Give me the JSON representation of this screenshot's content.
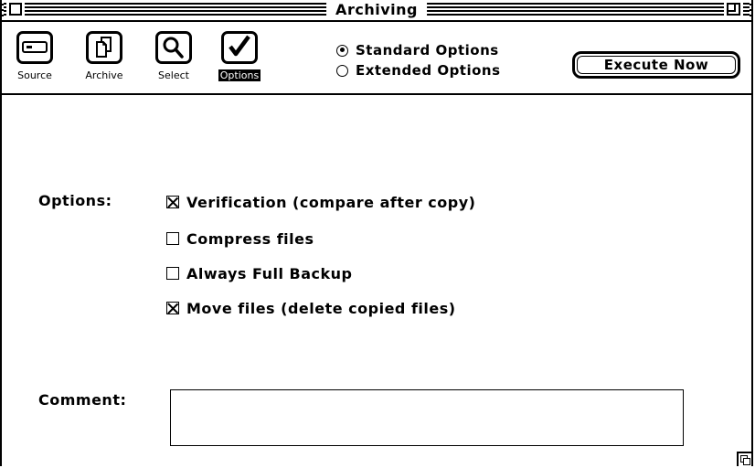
{
  "window": {
    "title": "Archiving"
  },
  "toolbar": {
    "tools": [
      {
        "label": "Source",
        "icon": "drive-icon",
        "selected": false
      },
      {
        "label": "Archive",
        "icon": "documents-icon",
        "selected": false
      },
      {
        "label": "Select",
        "icon": "magnifier-icon",
        "selected": false
      },
      {
        "label": "Options",
        "icon": "checkmark-icon",
        "selected": true
      }
    ],
    "mode": {
      "standard_label": "Standard Options",
      "extended_label": "Extended Options",
      "selected": "Standard Options"
    },
    "execute_label": "Execute Now"
  },
  "options": {
    "label": "Options:",
    "items": [
      {
        "label": "Verification (compare after copy)",
        "checked": true
      },
      {
        "label": "Compress files",
        "checked": false
      },
      {
        "label": "Always Full Backup",
        "checked": false
      },
      {
        "label": "Move files (delete copied files)",
        "checked": true
      }
    ]
  },
  "comment": {
    "label": "Comment:",
    "value": ""
  }
}
